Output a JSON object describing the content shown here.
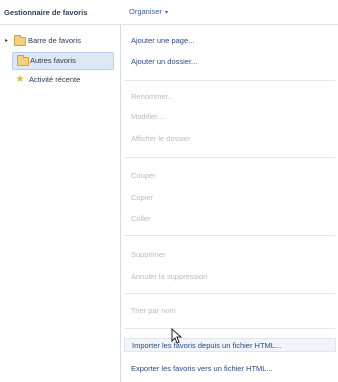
{
  "header": {
    "title": "Gestionnaire de favoris",
    "organize_label": "Organiser",
    "organize_caret": "▾"
  },
  "sidebar": {
    "items": [
      {
        "label": "Barre de favoris",
        "icon": "folder-icon",
        "expander": "▸",
        "selected": false
      },
      {
        "label": "Autres favoris",
        "icon": "folder-icon",
        "selected": true
      },
      {
        "label": "Activité récente",
        "icon": "star-icon",
        "star": "★",
        "selected": false
      }
    ]
  },
  "menu": {
    "items": [
      {
        "label": "Ajouter une page...",
        "enabled": true
      },
      {
        "label": "Ajouter un dossier...",
        "enabled": true
      },
      {
        "label": "Renommer...",
        "enabled": false
      },
      {
        "label": "Modifier...",
        "enabled": false
      },
      {
        "label": "Afficher le dossier",
        "enabled": false
      },
      {
        "label": "Couper",
        "enabled": false
      },
      {
        "label": "Copier",
        "enabled": false
      },
      {
        "label": "Coller",
        "enabled": false
      },
      {
        "label": "Supprimer",
        "enabled": false
      },
      {
        "label": "Annuler la suppression",
        "enabled": false
      },
      {
        "label": "Trier par nom",
        "enabled": false
      },
      {
        "label": "Importer les favoris depuis un fichier HTML...",
        "enabled": true,
        "hovered": true
      },
      {
        "label": "Exporter les favoris vers un fichier HTML...",
        "enabled": true
      }
    ]
  },
  "colors": {
    "selection_bg": "#dde8f5",
    "enabled_text": "#2b4a85",
    "disabled_text": "#b7bcc5"
  }
}
